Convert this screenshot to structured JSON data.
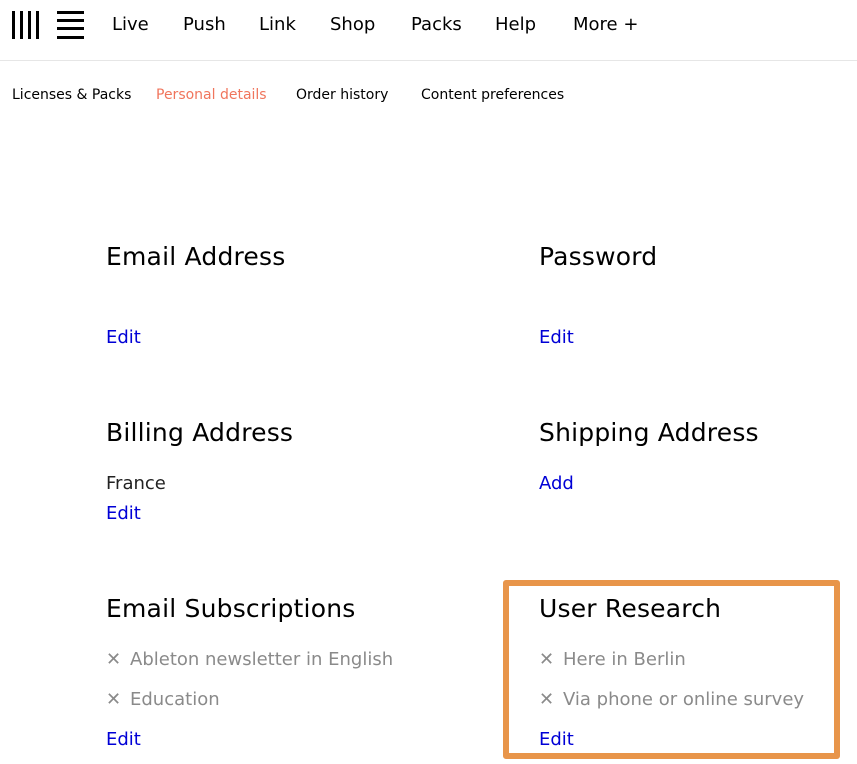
{
  "nav": {
    "main": [
      "Live",
      "Push",
      "Link",
      "Shop",
      "Packs",
      "Help",
      "More +"
    ],
    "sub": [
      "Licenses & Packs",
      "Personal details",
      "Order history",
      "Content preferences"
    ],
    "active_sub": "Personal details"
  },
  "sections": {
    "email": {
      "title": "Email Address",
      "edit": "Edit"
    },
    "password": {
      "title": "Password",
      "edit": "Edit"
    },
    "billing": {
      "title": "Billing Address",
      "value": "France",
      "edit": "Edit"
    },
    "shipping": {
      "title": "Shipping Address",
      "add": "Add"
    },
    "subscriptions": {
      "title": "Email Subscriptions",
      "items": [
        "Ableton newsletter in English",
        "Education"
      ],
      "edit": "Edit"
    },
    "research": {
      "title": "User Research",
      "items": [
        "Here in Berlin",
        "Via phone or online survey"
      ],
      "edit": "Edit"
    }
  },
  "colors": {
    "link": "#0000d6",
    "active_tab": "#f0755c",
    "highlight": "#e8954a",
    "muted": "#8a8a8a"
  },
  "icons": {
    "logo": "ableton-logo-icon",
    "unchecked": "close-x-icon"
  }
}
